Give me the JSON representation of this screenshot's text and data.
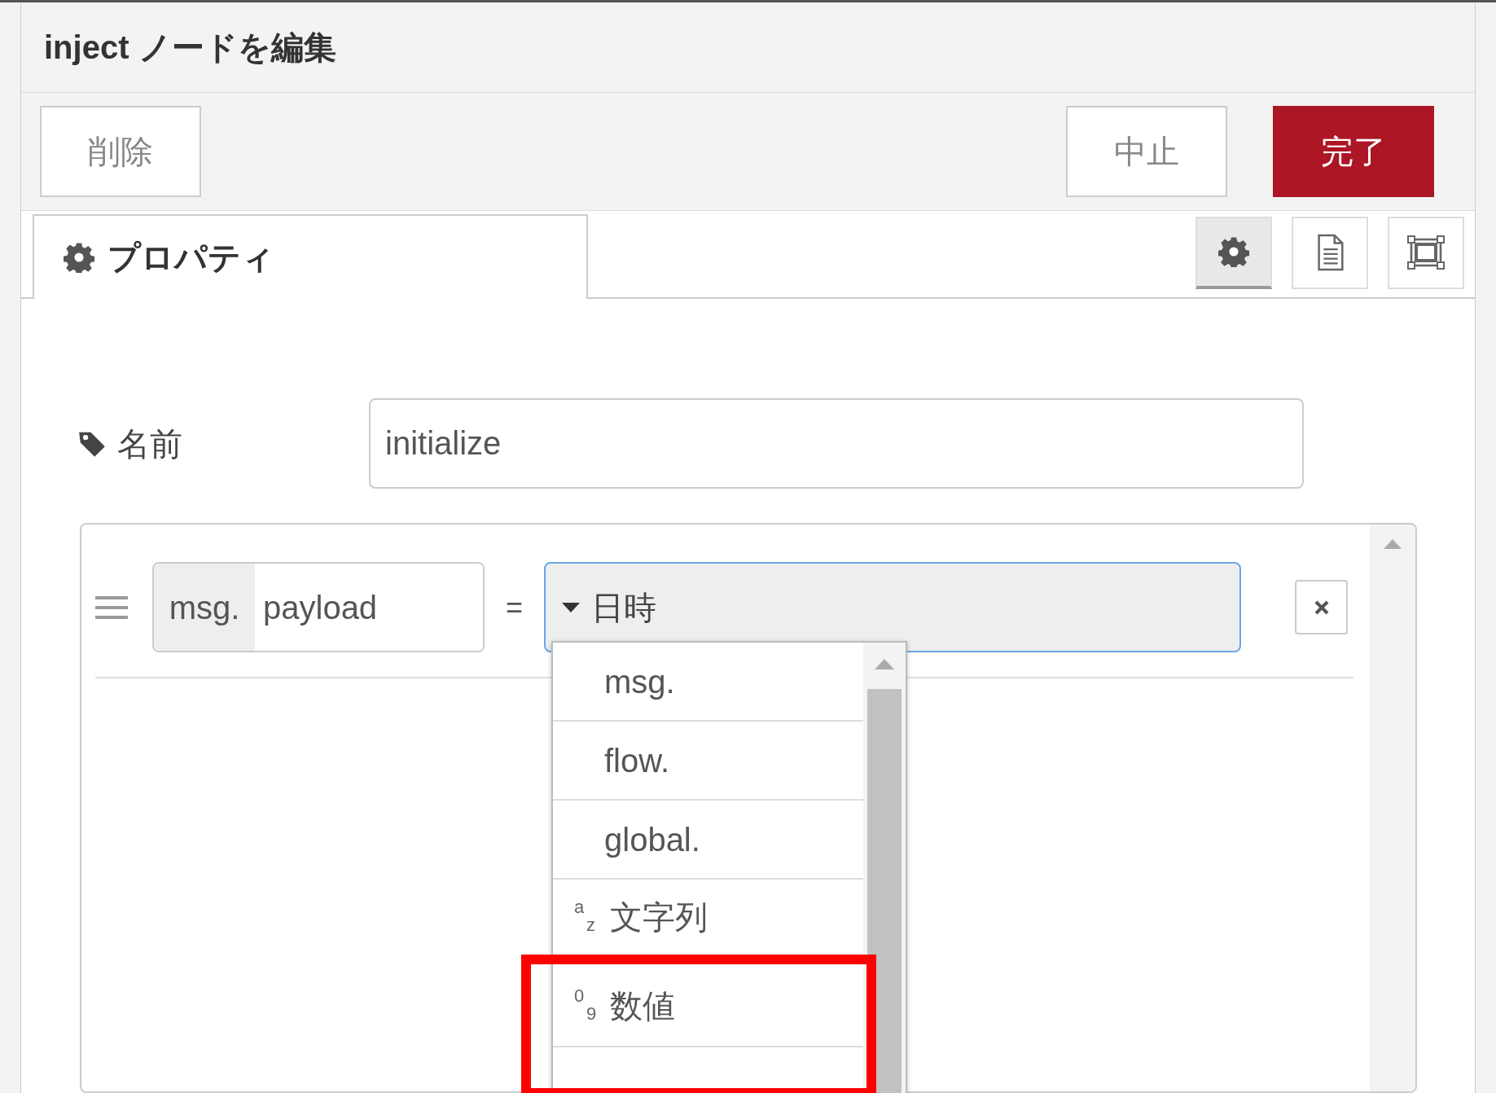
{
  "dialog": {
    "title": "inject ノードを編集"
  },
  "buttons": [
    {
      "label": "削除",
      "kind": "plain"
    },
    {
      "label": "中止",
      "kind": "plain"
    },
    {
      "label": "完了",
      "kind": "primary"
    }
  ],
  "tabs": [
    {
      "label": "プロパティ",
      "selected": true
    }
  ],
  "side_tabs": [
    {
      "kind": "settings",
      "selected": true
    },
    {
      "kind": "description",
      "selected": false
    },
    {
      "kind": "appearance",
      "selected": false
    }
  ],
  "name_field": {
    "label": "名前",
    "value": "initialize"
  },
  "properties": [
    {
      "prefix": "msg.",
      "property": "payload",
      "operator": "=",
      "value": "日時"
    }
  ],
  "type_menu": {
    "items": [
      {
        "label": "msg.",
        "kind": "context",
        "highlighted": false
      },
      {
        "label": "flow.",
        "kind": "context",
        "highlighted": false
      },
      {
        "label": "global.",
        "kind": "context",
        "highlighted": false
      },
      {
        "label": "文字列",
        "kind": "string",
        "icon_letters": [
          "a",
          "z"
        ],
        "highlighted": false
      },
      {
        "label": "数値",
        "kind": "number",
        "icon_letters": [
          "0",
          "9"
        ],
        "highlighted": true
      }
    ]
  }
}
